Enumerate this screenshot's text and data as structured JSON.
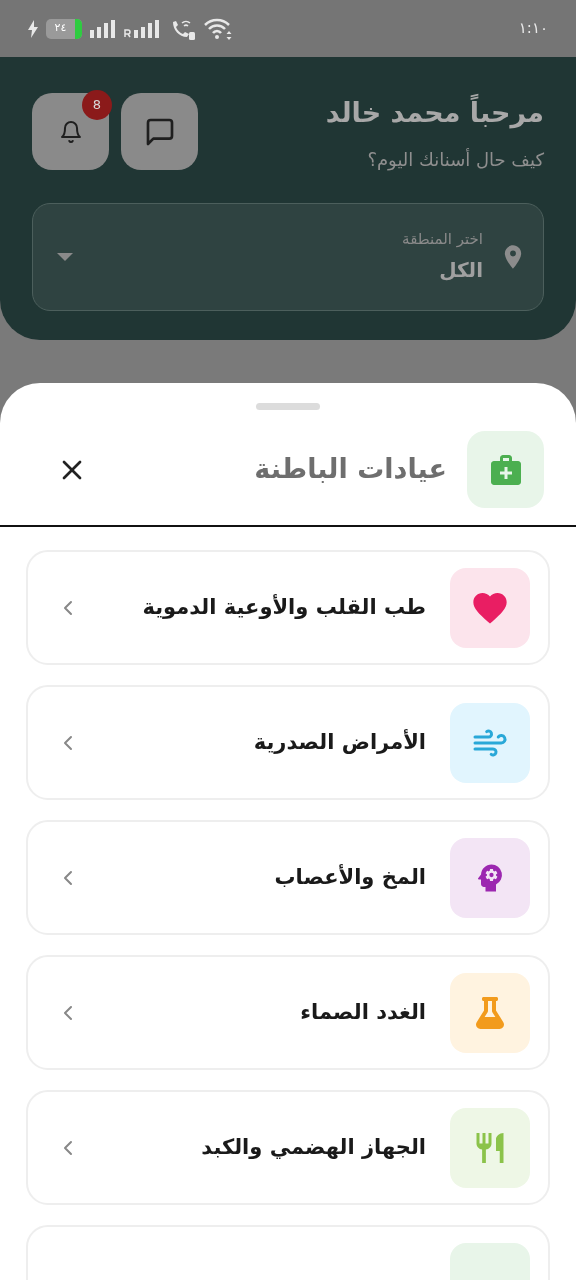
{
  "status_bar": {
    "time": "١:١٠",
    "battery": "٢٤"
  },
  "header": {
    "greeting": "مرحباً محمد خالد",
    "subtitle": "كيف حال أسنانك اليوم؟",
    "notifications": "8",
    "region": {
      "label": "اختر المنطقة",
      "value": "الكل"
    }
  },
  "sheet": {
    "title": "عيادات الباطنة",
    "items": [
      {
        "kind": "heart",
        "color": "#fce4ec",
        "title": "طب القلب والأوعية الدموية"
      },
      {
        "kind": "lungs",
        "color": "#e1f5fe",
        "title": "الأمراض الصدرية"
      },
      {
        "kind": "brain",
        "color": "#f3e5f5",
        "title": "المخ والأعصاب"
      },
      {
        "kind": "gland",
        "color": "#fff3e0",
        "title": "الغدد الصماء"
      },
      {
        "kind": "digestive",
        "color": "#eef7e6",
        "title": "الجهاز الهضمي والكبد"
      },
      {
        "kind": "partial",
        "color": "#e8f5e9"
      }
    ]
  }
}
